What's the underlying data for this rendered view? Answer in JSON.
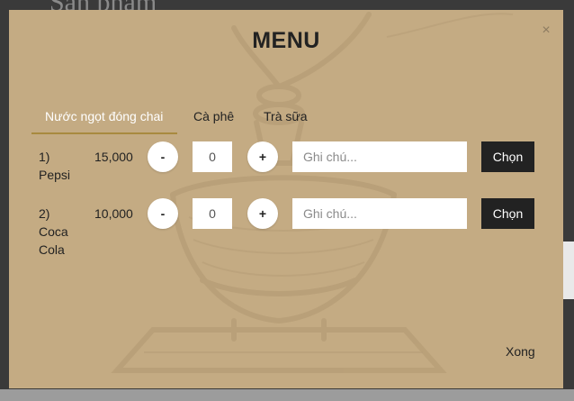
{
  "background": {
    "page_title": "Sản phẩm"
  },
  "modal": {
    "title": "MENU",
    "close_glyph": "×",
    "tabs": [
      {
        "label": "Nước ngọt đóng chai",
        "active": true
      },
      {
        "label": "Cà phê",
        "active": false
      },
      {
        "label": "Trà sữa",
        "active": false
      }
    ],
    "items": [
      {
        "index": "1)",
        "name": "Pepsi",
        "price": "15,000",
        "minus": "-",
        "plus": "+",
        "quantity": "0",
        "note_placeholder": "Ghi chú...",
        "choose_label": "Chọn"
      },
      {
        "index": "2)",
        "name": "Coca Cola",
        "price": "10,000",
        "minus": "-",
        "plus": "+",
        "quantity": "0",
        "note_placeholder": "Ghi chú...",
        "choose_label": "Chọn"
      }
    ],
    "done_label": "Xong"
  },
  "colors": {
    "modal_bg": "#c4ab83",
    "accent_underline": "#a88a3f",
    "button_dark": "#222222",
    "active_tab_text": "#ffffff"
  }
}
